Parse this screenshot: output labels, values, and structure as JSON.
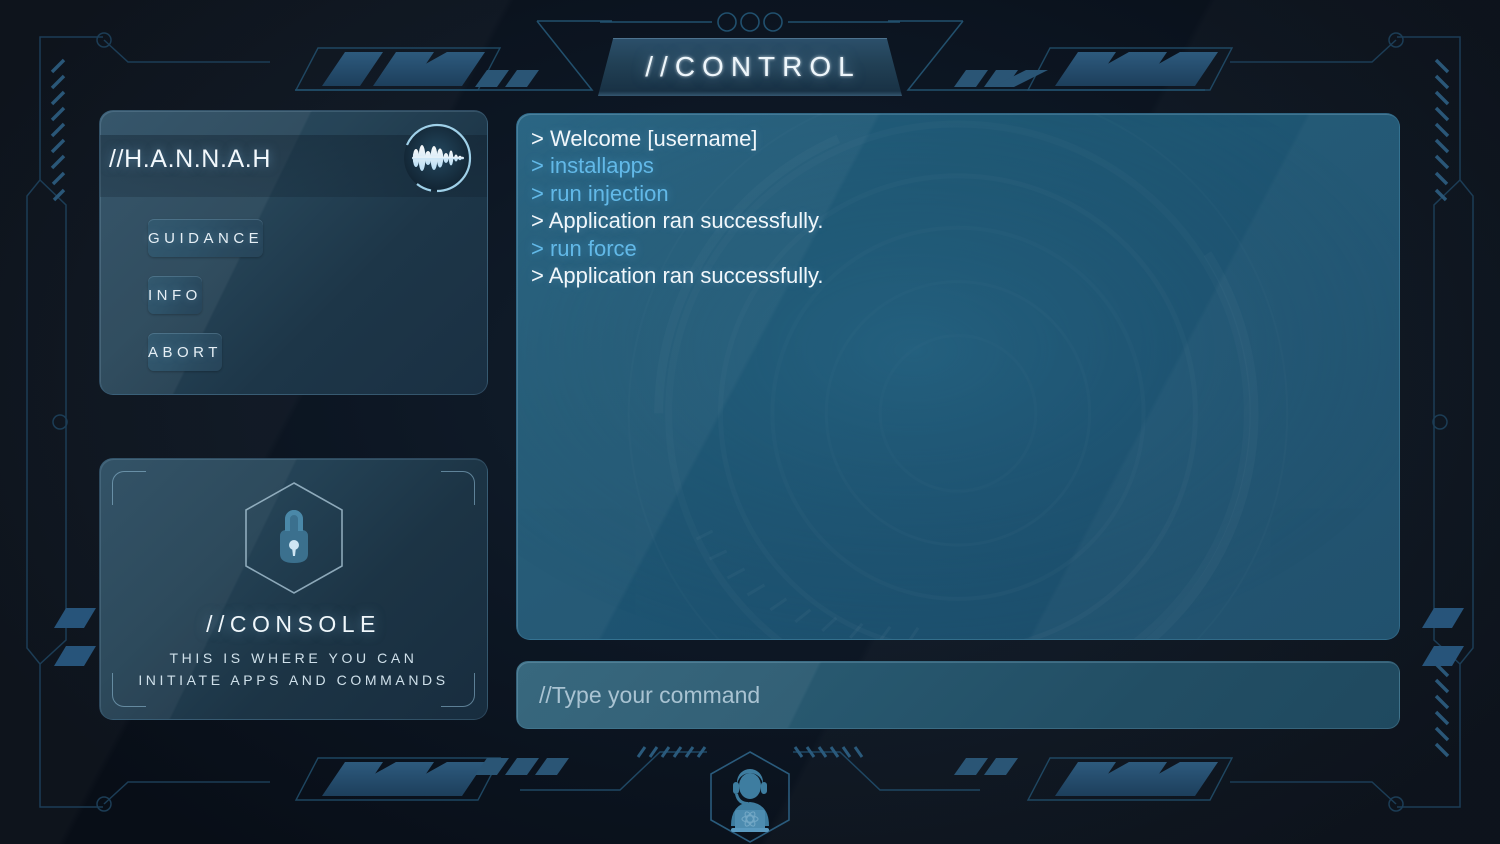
{
  "window": {
    "title": "//CONTROL",
    "status_dots": 3
  },
  "colors": {
    "background": "#0d1724",
    "panel_blue": "#1f5874",
    "accent_cyan": "#62b9e8",
    "frame_line": "#1d3b52",
    "text_primary": "#f1f7fb",
    "text_muted": "#a9c3d2",
    "chevron_fill": "#1d4straight"
  },
  "assistant_panel": {
    "name": "//H.A.N.N.A.H",
    "voice_icon": "waveform-icon",
    "buttons": [
      {
        "label": "GUIDANCE",
        "name": "guidance"
      },
      {
        "label": "INFO",
        "name": "info"
      },
      {
        "label": "ABORT",
        "name": "abort"
      }
    ]
  },
  "console_panel": {
    "icon": "lock-hexagon-icon",
    "title": "//CONSOLE",
    "description_line1": "THIS IS WHERE YOU CAN",
    "description_line2": "INITIATE APPS AND COMMANDS"
  },
  "terminal": {
    "lines": [
      {
        "text": "> Welcome [username]",
        "type": "output"
      },
      {
        "text": "> installapps",
        "type": "command"
      },
      {
        "text": "> run injection",
        "type": "command"
      },
      {
        "text": "> Application ran successfully.",
        "type": "output"
      },
      {
        "text": "> run force",
        "type": "command"
      },
      {
        "text": "> Application ran successfully.",
        "type": "output"
      }
    ]
  },
  "command_input": {
    "value": "",
    "placeholder": "//Type your command"
  },
  "footer": {
    "operator_icon": "operator-headset-icon"
  }
}
